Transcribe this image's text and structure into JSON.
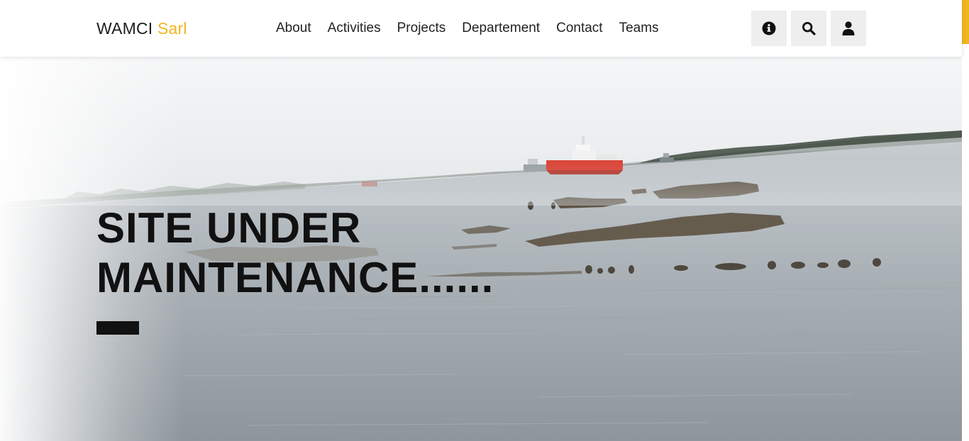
{
  "navbar": {
    "brand": {
      "name": "WAMCI",
      "suffix": "Sarl"
    },
    "links": [
      {
        "label": "About"
      },
      {
        "label": "Activities"
      },
      {
        "label": "Projects"
      },
      {
        "label": "Departement"
      },
      {
        "label": "Contact"
      },
      {
        "label": "Teams"
      }
    ],
    "icons": [
      {
        "name": "info-icon"
      },
      {
        "name": "search-icon"
      },
      {
        "name": "user-icon"
      }
    ]
  },
  "hero": {
    "heading_line1": "SITE UNDER",
    "heading_line2": "MAINTENANCE......"
  },
  "colors": {
    "accent": "#f2b51f",
    "text": "#111111",
    "icon_button_bg": "#eeeeee"
  }
}
